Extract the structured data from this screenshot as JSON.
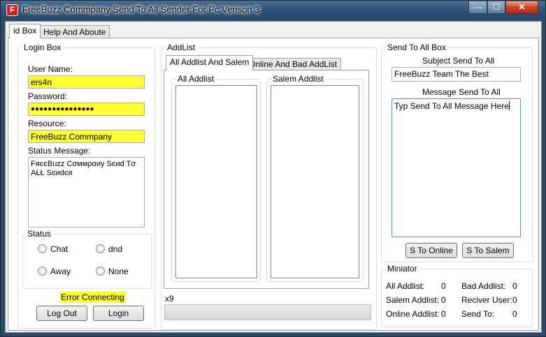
{
  "window": {
    "title": "FreeBuzz Commpany Send To All Sender For Pc Verison 3",
    "app_icon_letter": "F",
    "controls": {
      "minimize": "—",
      "maximize": "☐",
      "close": "✕"
    }
  },
  "tabs": [
    {
      "label": "id Box"
    },
    {
      "label": "Help And Aboute"
    }
  ],
  "login_box": {
    "title": "Login Box",
    "username_label": "User Name:",
    "username_value": "ers4n",
    "password_label": "Password:",
    "password_value": "●●●●●●●●●●●●●●●",
    "resource_label": "Resource:",
    "resource_value": "FreeBuzz Commpany",
    "status_message_label": "Status Message:",
    "status_message_value": "FяєєBuzz Cσммραиу Sєиd Tσ ΑŁŁ Sєиdєя",
    "status_group": {
      "title": "Status",
      "options": [
        "Chat",
        "dnd",
        "Away",
        "None"
      ]
    },
    "error_text": "Error Connecting",
    "logout_label": "Log Out",
    "login_label": "Login"
  },
  "addlist": {
    "title": "AddList",
    "tabs": [
      "All Addlist And Salem",
      "Online And Bad AddList"
    ],
    "all_addlist_title": "All Addlist",
    "salem_addlist_title": "Salem Addlist",
    "progress_label": "x9",
    "progress_value": 0
  },
  "send_box": {
    "title": "Send To All Box",
    "subject_label": "Subject Send To All",
    "subject_value": "FreeBuzz Team The Best",
    "message_label": "Message Send To All",
    "message_value": "Typ Send To All Message Here",
    "send_online_label": "S To Online",
    "send_salem_label": "S To Salem"
  },
  "miniator": {
    "title": "Miniator",
    "rows": [
      {
        "left_label": "All Addlist:",
        "left_value": "0",
        "right_label": "Bad Addlist:",
        "right_value": "0"
      },
      {
        "left_label": "Salem Addlist:",
        "left_value": "0",
        "right_label": "Reciver User:",
        "right_value": "0"
      },
      {
        "left_label": "Online Addlist:",
        "left_value": "0",
        "right_label": "Send To:",
        "right_value": "0"
      }
    ]
  },
  "colors": {
    "titlebar": "#2e5176",
    "field_highlight": "#ffff33",
    "close_button": "#c7432b"
  }
}
